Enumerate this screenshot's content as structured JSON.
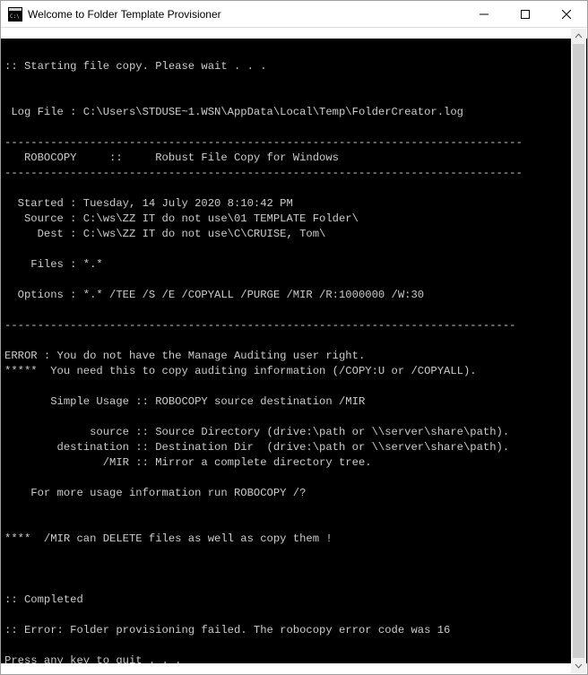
{
  "titlebar": {
    "title": "Welcome to Folder Template Provisioner"
  },
  "console": {
    "lines": [
      "",
      ":: Starting file copy. Please wait . . .",
      "",
      "",
      " Log File : C:\\Users\\STDUSE~1.WSN\\AppData\\Local\\Temp\\FolderCreator.log",
      "",
      "-------------------------------------------------------------------------------",
      "   ROBOCOPY     ::     Robust File Copy for Windows",
      "-------------------------------------------------------------------------------",
      "",
      "  Started : Tuesday, 14 July 2020 8:10:42 PM",
      "   Source : C:\\ws\\ZZ IT do not use\\01 TEMPLATE Folder\\",
      "     Dest : C:\\ws\\ZZ IT do not use\\C\\CRUISE, Tom\\",
      "",
      "    Files : *.*",
      "",
      "  Options : *.* /TEE /S /E /COPYALL /PURGE /MIR /R:1000000 /W:30",
      "",
      "------------------------------------------------------------------------------",
      "",
      "ERROR : You do not have the Manage Auditing user right.",
      "*****  You need this to copy auditing information (/COPY:U or /COPYALL).",
      "",
      "       Simple Usage :: ROBOCOPY source destination /MIR",
      "",
      "             source :: Source Directory (drive:\\path or \\\\server\\share\\path).",
      "        destination :: Destination Dir  (drive:\\path or \\\\server\\share\\path).",
      "               /MIR :: Mirror a complete directory tree.",
      "",
      "    For more usage information run ROBOCOPY /?",
      "",
      "",
      "****  /MIR can DELETE files as well as copy them !",
      "",
      "",
      "",
      ":: Completed",
      "",
      ":: Error: Folder provisioning failed. The robocopy error code was 16",
      "",
      "Press any key to quit . . ."
    ]
  }
}
